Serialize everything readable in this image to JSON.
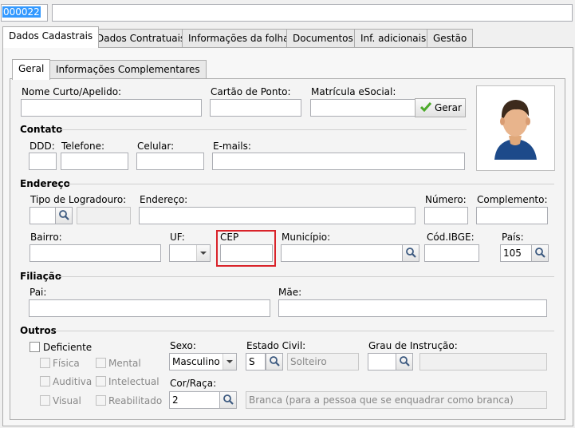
{
  "header": {
    "code_value": "000022",
    "name_value": ""
  },
  "tabs": [
    {
      "label": "Dados Cadastrais"
    },
    {
      "label": "Dados Contratuais"
    },
    {
      "label": "Informações da folha"
    },
    {
      "label": "Documentos"
    },
    {
      "label": "Inf. adicionais"
    },
    {
      "label": "Gestão"
    }
  ],
  "subtabs": [
    {
      "label": "Geral"
    },
    {
      "label": "Informações Complementares"
    }
  ],
  "fields": {
    "nome_curto": {
      "label": "Nome Curto/Apelido:",
      "value": ""
    },
    "cartao_ponto": {
      "label": "Cartão de Ponto:",
      "value": ""
    },
    "matricula": {
      "label": "Matrícula eSocial:",
      "value": "",
      "button": "Gerar"
    }
  },
  "contato": {
    "title": "Contato",
    "ddd": "DDD:",
    "telefone": "Telefone:",
    "celular": "Celular:",
    "emails": "E-mails:"
  },
  "endereco": {
    "title": "Endereço",
    "tipo_logradouro": "Tipo de Logradouro:",
    "endereco": "Endereço:",
    "numero": "Número:",
    "complemento": "Complemento:",
    "bairro": "Bairro:",
    "uf": "UF:",
    "cep": "CEP",
    "municipio": "Município:",
    "cod_ibge": "Cód.IBGE:",
    "pais": "País:",
    "pais_value": "105"
  },
  "filiacao": {
    "title": "Filiação",
    "pai": "Pai:",
    "mae": "Mãe:"
  },
  "outros": {
    "title": "Outros",
    "deficiente": "Deficiente",
    "fisica": "Física",
    "mental": "Mental",
    "auditiva": "Auditiva",
    "intelectual": "Intelectual",
    "visual": "Visual",
    "reabilitado": "Reabilitado",
    "sexo_label": "Sexo:",
    "sexo_value": "Masculino",
    "estado_civil_label": "Estado Civil:",
    "estado_civil_code": "S",
    "estado_civil_desc": "Solteiro",
    "grau_label": "Grau de Instrução:",
    "cor_label": "Cor/Raça:",
    "cor_code": "2",
    "cor_desc": "Branca (para a pessoa que se enquadrar como branca)"
  },
  "colors": {
    "highlight": "#d9232a",
    "selection": "#3399ff"
  }
}
